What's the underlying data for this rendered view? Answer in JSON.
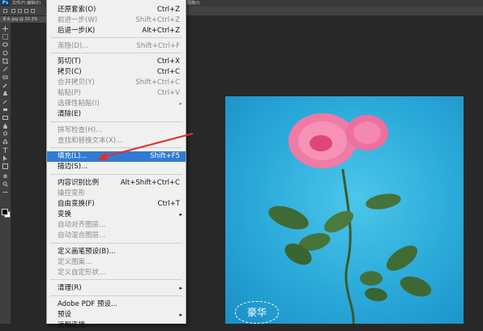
{
  "app": {
    "logo": "Ps",
    "menubar": [
      "文件(F)",
      "编辑(E)",
      "图像(I)"
    ],
    "document_tab": "青水.jpg @ 33.3%"
  },
  "colors": {
    "menu_bg": "#f0f0f0",
    "highlight": "#2f7bd4",
    "arrow": "#e0302c",
    "photo_bg": "#2aa9d9"
  },
  "edit_menu": {
    "items": [
      {
        "label": "还原套索(O)",
        "shortcut": "Ctrl+Z",
        "state": "enabled"
      },
      {
        "label": "前进一步(W)",
        "shortcut": "Shift+Ctrl+Z",
        "state": "disabled"
      },
      {
        "label": "后退一步(K)",
        "shortcut": "Alt+Ctrl+Z",
        "state": "enabled"
      },
      {
        "label": "渐隐(D)...",
        "shortcut": "Shift+Ctrl+F",
        "state": "disabled"
      },
      {
        "label": "剪切(T)",
        "shortcut": "Ctrl+X",
        "state": "enabled"
      },
      {
        "label": "拷贝(C)",
        "shortcut": "Ctrl+C",
        "state": "enabled"
      },
      {
        "label": "合并拷贝(Y)",
        "shortcut": "Shift+Ctrl+C",
        "state": "disabled"
      },
      {
        "label": "粘贴(P)",
        "shortcut": "Ctrl+V",
        "state": "disabled"
      },
      {
        "label": "选择性粘贴(I)",
        "shortcut": "",
        "state": "disabled",
        "submenu": true
      },
      {
        "label": "清除(E)",
        "shortcut": "",
        "state": "enabled"
      },
      {
        "label": "拼写检查(H)...",
        "shortcut": "",
        "state": "disabled"
      },
      {
        "label": "查找和替换文本(X)...",
        "shortcut": "",
        "state": "disabled"
      },
      {
        "label": "填充(L)...",
        "shortcut": "Shift+F5",
        "state": "highlighted"
      },
      {
        "label": "描边(S)...",
        "shortcut": "",
        "state": "enabled"
      },
      {
        "label": "内容识别比例",
        "shortcut": "Alt+Shift+Ctrl+C",
        "state": "enabled"
      },
      {
        "label": "操控变形",
        "shortcut": "",
        "state": "disabled"
      },
      {
        "label": "自由变换(F)",
        "shortcut": "Ctrl+T",
        "state": "enabled"
      },
      {
        "label": "变换",
        "shortcut": "",
        "state": "enabled",
        "submenu": true
      },
      {
        "label": "自动对齐图层...",
        "shortcut": "",
        "state": "disabled"
      },
      {
        "label": "自动混合图层...",
        "shortcut": "",
        "state": "disabled"
      },
      {
        "label": "定义画笔预设(B)...",
        "shortcut": "",
        "state": "enabled"
      },
      {
        "label": "定义图案...",
        "shortcut": "",
        "state": "disabled"
      },
      {
        "label": "定义自定形状...",
        "shortcut": "",
        "state": "disabled"
      },
      {
        "label": "清理(R)",
        "shortcut": "",
        "state": "enabled",
        "submenu": true
      },
      {
        "label": "Adobe PDF 预设...",
        "shortcut": "",
        "state": "enabled"
      },
      {
        "label": "预设",
        "shortcut": "",
        "state": "enabled",
        "submenu": true
      },
      {
        "label": "远程连接...",
        "shortcut": "",
        "state": "enabled"
      }
    ],
    "submenu_arrow": "▸"
  },
  "canvas": {
    "watermark_text": "豪华"
  }
}
